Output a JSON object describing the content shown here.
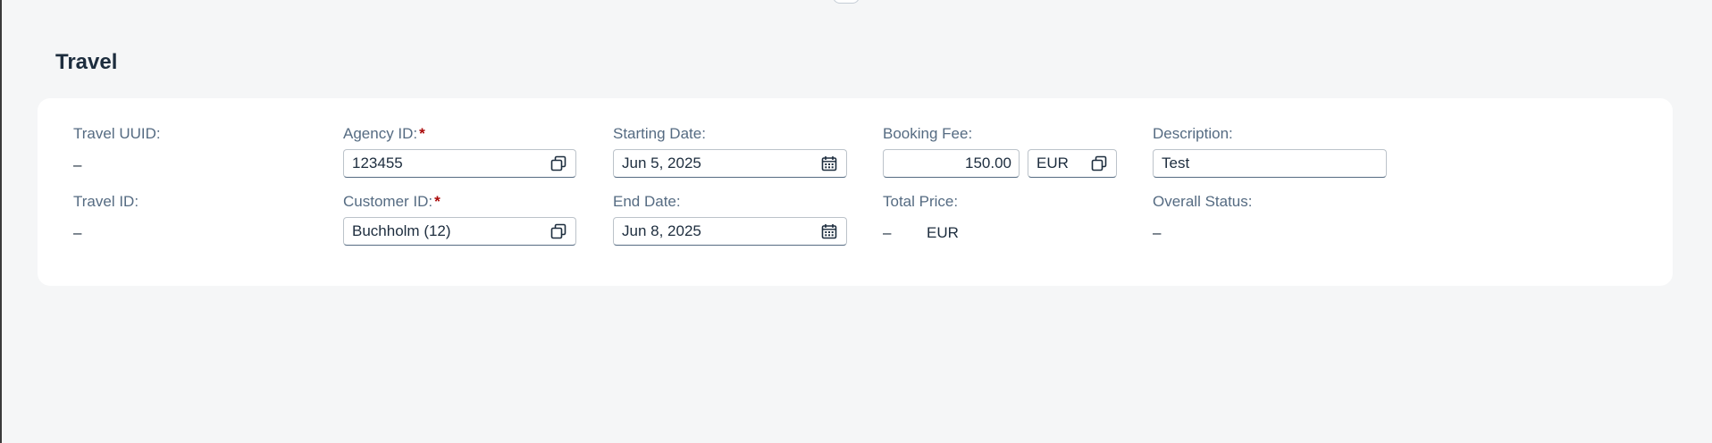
{
  "section": {
    "title": "Travel"
  },
  "fields": {
    "travel_uuid": {
      "label": "Travel UUID:",
      "value": "–"
    },
    "travel_id": {
      "label": "Travel ID:",
      "value": "–"
    },
    "agency_id": {
      "label": "Agency ID:",
      "required_mark": "*",
      "value": "123455",
      "icon": "value-help-icon"
    },
    "customer_id": {
      "label": "Customer ID:",
      "required_mark": "*",
      "value": "Buchholm (12)",
      "icon": "value-help-icon"
    },
    "starting_date": {
      "label": "Starting Date:",
      "value": "Jun 5, 2025",
      "icon": "calendar-icon"
    },
    "end_date": {
      "label": "End Date:",
      "value": "Jun 8, 2025",
      "icon": "calendar-icon"
    },
    "booking_fee": {
      "label": "Booking Fee:",
      "value": "150.00",
      "currency": "EUR",
      "icon": "value-help-icon"
    },
    "total_price": {
      "label": "Total Price:",
      "value": "–",
      "currency": "EUR"
    },
    "description": {
      "label": "Description:",
      "value": "Test"
    },
    "overall_status": {
      "label": "Overall Status:",
      "value": "–"
    }
  },
  "colors": {
    "background": "#f5f6f7",
    "card": "#ffffff",
    "label": "#556b82",
    "text": "#1d2d3e",
    "required": "#aa0808",
    "input_border": "#bcc3ca"
  }
}
